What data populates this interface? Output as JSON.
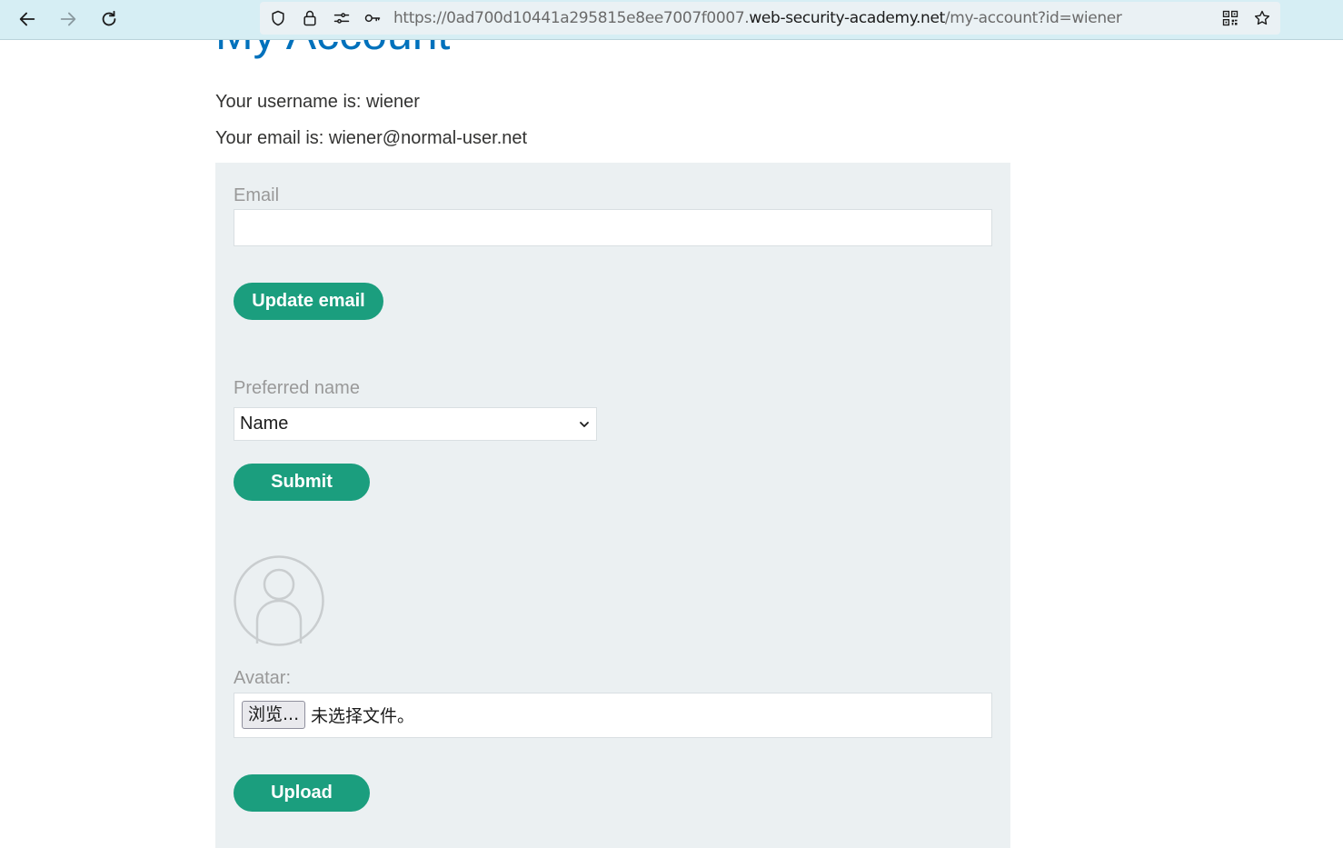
{
  "browser": {
    "url_prefix": "https://0ad700d10441a295815e8ee7007f0007.",
    "url_host": "web-security-academy.net",
    "url_path": "/my-account?id=wiener"
  },
  "page": {
    "title": "My Account",
    "username_line": "Your username is: wiener",
    "email_line": "Your email is: wiener@normal-user.net"
  },
  "email_form": {
    "label": "Email",
    "value": "",
    "placeholder": "",
    "button": "Update email"
  },
  "name_form": {
    "label": "Preferred name",
    "selected": "Name",
    "button": "Submit"
  },
  "avatar_form": {
    "label": "Avatar:",
    "browse_button": "浏览...",
    "no_file_text": "未选择文件。",
    "button": "Upload"
  },
  "colors": {
    "accent": "#1b9e7e",
    "title": "#0071bc",
    "panel": "#ebf0f2",
    "browser_bar": "#d6eef4"
  }
}
